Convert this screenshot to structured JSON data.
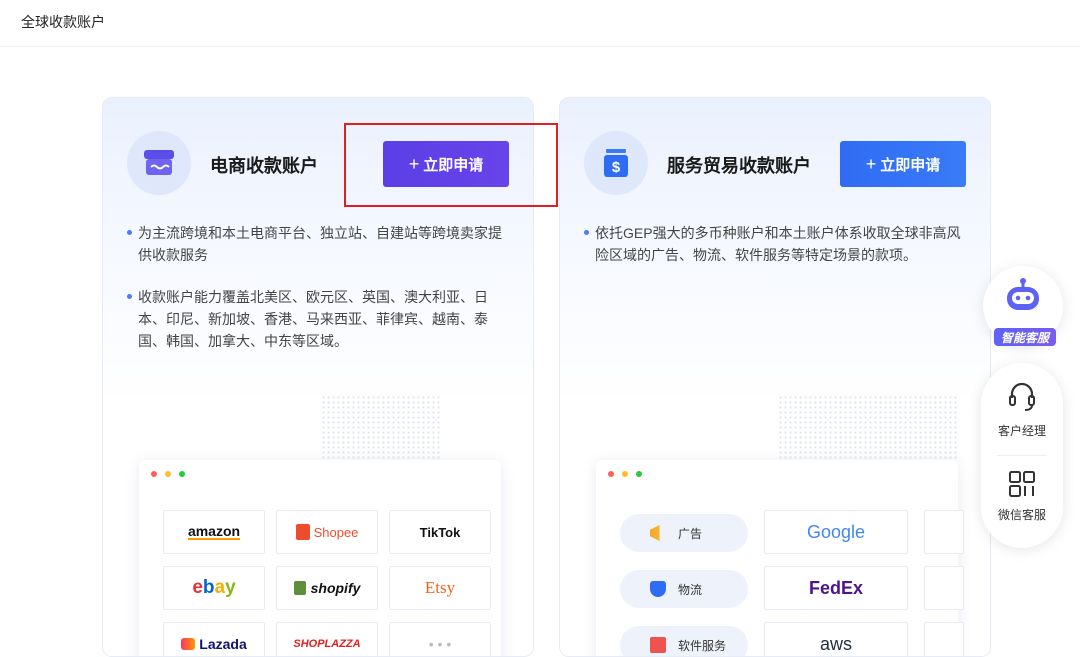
{
  "header": {
    "title": "全球收款账户"
  },
  "ecommerce": {
    "title": "电商收款账户",
    "apply_label": "立即申请",
    "plus": "+",
    "desc1": "为主流跨境和本土电商平台、独立站、自建站等跨境卖家提供收款服务",
    "desc2": "收款账户能力覆盖北美区、欧元区、英国、澳大利亚、日本、印尼、新加坡、香港、马来西亚、菲律宾、越南、泰国、韩国、加拿大、中东等区域。",
    "logos": [
      "amazon",
      "Shopee",
      "TikTok",
      "ebay",
      "shopify",
      "Etsy",
      "Lazada",
      "SHOPLAZZA"
    ]
  },
  "services": {
    "title": "服务贸易收款账户",
    "apply_label": "立即申请",
    "plus": "+",
    "desc1": "依托GEP强大的多币种账户和本土账户体系收取全球非高风险区域的广告、物流、软件服务等特定场景的款项。",
    "categories": [
      "广告",
      "物流",
      "软件服务"
    ],
    "logos": [
      "Google",
      "FedEx",
      "aws"
    ]
  },
  "float_panel": {
    "robot_label": "智能客服",
    "manager_label": "客户经理",
    "wechat_label": "微信客服"
  },
  "colors": {
    "ecommerce_btn": "#5b3fe6",
    "services_btn": "#2f6cf4",
    "highlight": "#e02020"
  }
}
